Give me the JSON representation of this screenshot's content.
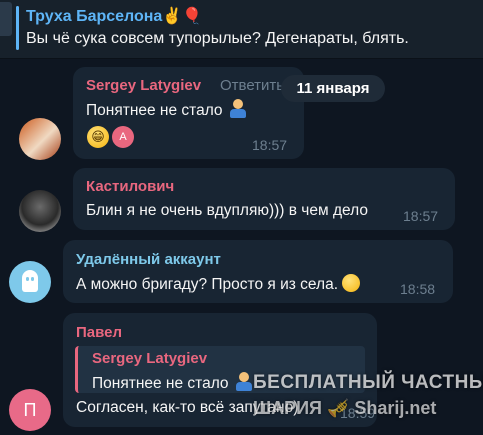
{
  "top_message": {
    "author": "Труха Барселона",
    "author_emoji": "✌️🎈",
    "text": "Вы чё сука совсем тупорылые? Дегенараты, блять."
  },
  "date_divider": "11 января",
  "messages": [
    {
      "author": "Sergey Latygiev",
      "author_color": "#e9677f",
      "reply_label": "Ответить",
      "text": "Понятнее не стало",
      "reactions": [
        "😁",
        "A"
      ],
      "time": "18:57"
    },
    {
      "author": "Кастилович",
      "author_color": "#e9677f",
      "text": "Блин я не очень вдупляю))) в чем дело",
      "time": "18:57"
    },
    {
      "author": "Удалённый аккаунт",
      "author_color": "#7ec9ea",
      "text": "А можно бригаду? Просто я из села.",
      "time": "18:58"
    },
    {
      "author": "Павел",
      "author_color": "#e9677f",
      "avatar_letter": "П",
      "quote_author": "Sergey Latygiev",
      "quote_text": "Понятнее не стало",
      "text": "Согласен, как-то всё запутано)",
      "time": "18:59"
    }
  ],
  "watermark": {
    "line1": "БЕСПЛАТНЫЙ ЧАСТНЫЙ",
    "line2": "ШАРИЯ 🎺 Sharij.net"
  }
}
